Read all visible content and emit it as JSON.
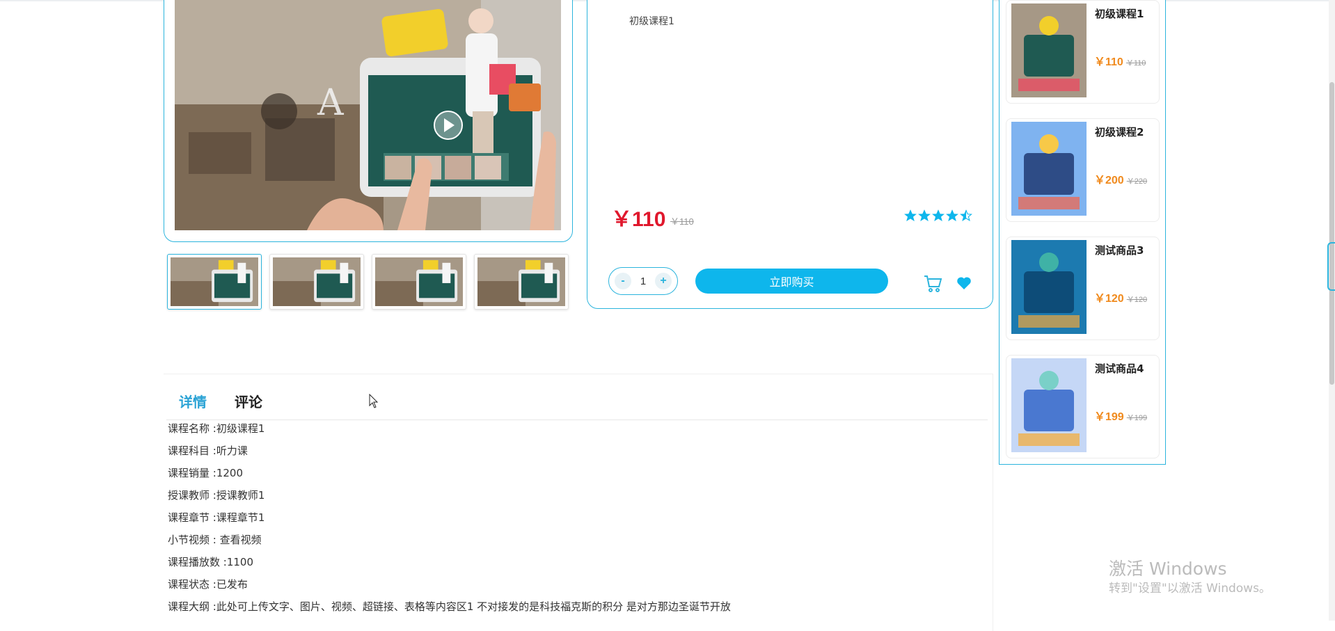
{
  "product": {
    "description": "初级课程1",
    "price": "￥110",
    "old_price": "￥110",
    "rating": 4.5,
    "quantity": "1",
    "minus_label": "-",
    "plus_label": "+",
    "buy_label": "立即购买",
    "thumbnail_count": 4,
    "accent_color": "#0eb6ec",
    "price_color": "#e0182d"
  },
  "tabs": [
    {
      "label": "详情",
      "active": true
    },
    {
      "label": "评论",
      "active": false
    }
  ],
  "details": [
    "课程名称 :初级课程1",
    "课程科目 :听力课",
    "课程销量 :1200",
    "授课教师 :授课教师1",
    "课程章节 :课程章节1",
    "小节视频 : 查看视频",
    "课程播放数 :1100",
    "课程状态 :已发布",
    "课程大纲 :此处可上传文字、图片、视频、超链接、表格等内容区1 不对接发的是科技福克斯的积分 是对方那边圣诞节开放"
  ],
  "recommendations": [
    {
      "title": "初级课程1",
      "price": "￥110",
      "old_price": "￥110",
      "theme": "classroom"
    },
    {
      "title": "初级课程2",
      "price": "￥200",
      "old_price": "￥220",
      "theme": "online-class"
    },
    {
      "title": "测试商品3",
      "price": "￥120",
      "old_price": "￥120",
      "theme": "business"
    },
    {
      "title": "测试商品4",
      "price": "￥199",
      "old_price": "￥199",
      "theme": "study-girl"
    }
  ],
  "icons": {
    "cart": "cart-icon",
    "favorite": "heart-icon",
    "rating": "star-icon",
    "play": "play-icon"
  },
  "watermark": {
    "line1": "激活 Windows",
    "line2": "转到\"设置\"以激活 Windows。"
  }
}
